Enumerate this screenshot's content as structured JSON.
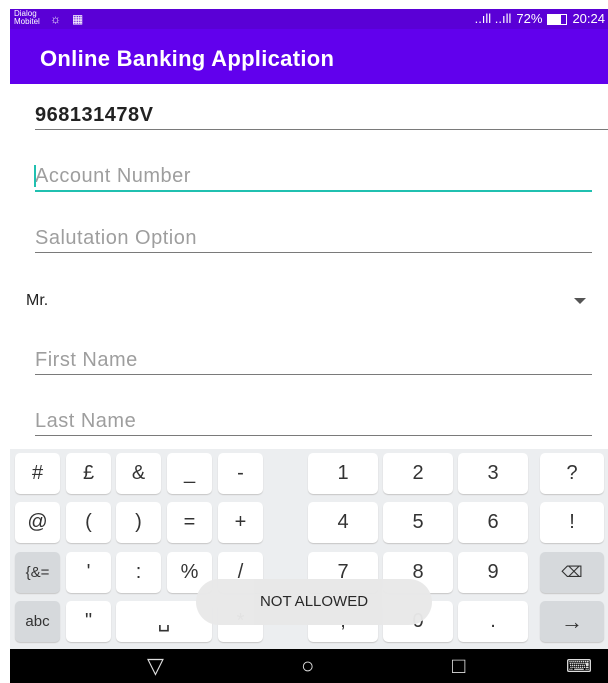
{
  "status_bar": {
    "carrier_line1": "Dialog",
    "carrier_line2": "Mobitel",
    "signal": "..ıll ..ıll",
    "battery_percent": "72%",
    "time": "20:24",
    "icons": [
      "whatsapp-icon",
      "image-icon",
      "signal-icon",
      "battery-icon"
    ]
  },
  "app_bar": {
    "title": "Online Banking Application"
  },
  "form": {
    "nic_value": "968131478V",
    "account_number_hint": "Account Number",
    "salutation_hint": "Salutation Option",
    "salutation_selected": "Mr.",
    "first_name_hint": "First Name",
    "last_name_hint": "Last Name"
  },
  "keyboard": {
    "row1": [
      "#",
      "£",
      "&",
      "_",
      "-",
      "1",
      "2",
      "3",
      "?"
    ],
    "row2": [
      "@",
      "(",
      ")",
      "=",
      "+",
      "4",
      "5",
      "6",
      "!"
    ],
    "row3": [
      "{&=",
      "'",
      ":",
      "%",
      "/",
      "7",
      "8",
      "9",
      "⌫"
    ],
    "row4": [
      "abc",
      "\"",
      "␣",
      "*",
      ",",
      "0",
      ".",
      "→"
    ]
  },
  "toast": {
    "message": "NOT ALLOWED"
  },
  "nav_bar": {
    "back": "▽",
    "home": "○",
    "recents": "□",
    "keyboard": "⌨"
  }
}
